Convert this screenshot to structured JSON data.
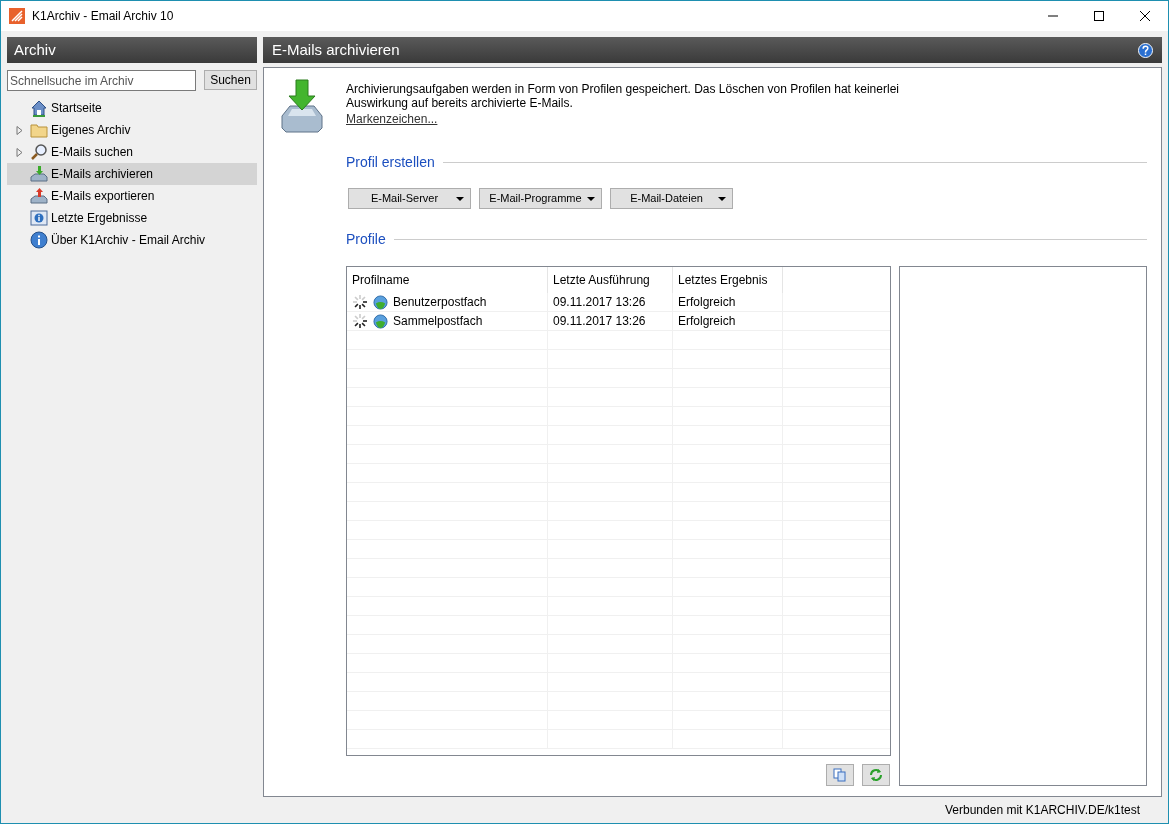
{
  "window": {
    "title": "K1Archiv - Email Archiv 10"
  },
  "sidebar": {
    "title": "Archiv",
    "search": {
      "placeholder": "Schnellsuche im Archiv"
    },
    "search_button": "Suchen",
    "items": [
      {
        "label": "Startseite",
        "kind": "home",
        "selected": false
      },
      {
        "label": "Eigenes Archiv",
        "kind": "folder",
        "selected": false,
        "expanded": false
      },
      {
        "label": "E-Mails suchen",
        "kind": "search",
        "selected": false,
        "expanded": false
      },
      {
        "label": "E-Mails archivieren",
        "kind": "archive",
        "selected": true
      },
      {
        "label": "E-Mails exportieren",
        "kind": "export",
        "selected": false
      },
      {
        "label": "Letzte Ergebnisse",
        "kind": "results",
        "selected": false
      },
      {
        "label": "Über K1Archiv - Email Archiv",
        "kind": "info",
        "selected": false
      }
    ]
  },
  "main": {
    "title": "E-Mails archivieren",
    "description": "Archivierungsaufgaben werden in Form von Profilen gespeichert. Das Löschen von Profilen hat keinerlei Auswirkung auf bereits archivierte E-Mails.",
    "link": "Markenzeichen...",
    "create_section": "Profil erstellen",
    "create_buttons": [
      "E-Mail-Server",
      "E-Mail-Programme",
      "E-Mail-Dateien"
    ],
    "profiles_section": "Profile",
    "table": {
      "columns": [
        "Profilname",
        "Letzte Ausführung",
        "Letztes Ergebnis"
      ],
      "rows": [
        [
          "Benutzerpostfach",
          "09.11.2017 13:26",
          "Erfolgreich"
        ],
        [
          "Sammelpostfach",
          "09.11.2017 13:26",
          "Erfolgreich"
        ]
      ]
    }
  },
  "status_bar": "Verbunden mit K1ARCHIV.DE/k1test"
}
